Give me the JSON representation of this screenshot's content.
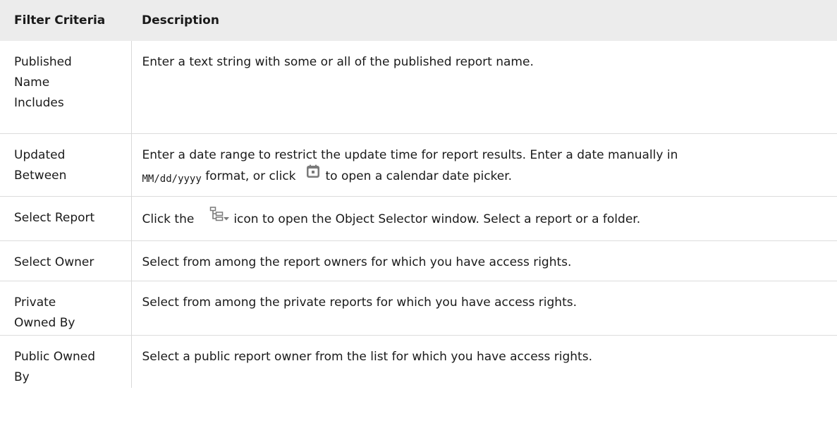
{
  "table": {
    "headers": {
      "criteria": "Filter Criteria",
      "description": "Description"
    },
    "rows": [
      {
        "criteria": [
          "Published",
          "Name",
          "Includes"
        ],
        "description": "Enter a text string with some or all of the published report name."
      },
      {
        "criteria": [
          "Updated",
          "Between"
        ],
        "description_line1": "Enter a date range to restrict the update time for report results. Enter a date manually in",
        "date_format": "MM/dd/yyyy",
        "description_line2_pre": " format, or click",
        "icon": "calendar-icon",
        "description_line2_post": "to open a calendar date picker."
      },
      {
        "criteria": [
          "Select Report"
        ],
        "description_pre": "Click the",
        "icon": "object-selector-tree-icon",
        "description_post": "icon to open the Object Selector window. Select a report or a folder."
      },
      {
        "criteria": [
          "Select Owner"
        ],
        "description": "Select from among the report owners for which you have access rights."
      },
      {
        "criteria": [
          "Private",
          "Owned By"
        ],
        "description": "Select from among the private reports for which you have access rights."
      },
      {
        "criteria": [
          "Public Owned",
          "By"
        ],
        "description": "Select a public report owner from the list for which you have access rights."
      }
    ]
  },
  "colors": {
    "header_bg": "#ececec",
    "border": "#dcdcdc",
    "icon_gray": "#7a7a7a"
  }
}
